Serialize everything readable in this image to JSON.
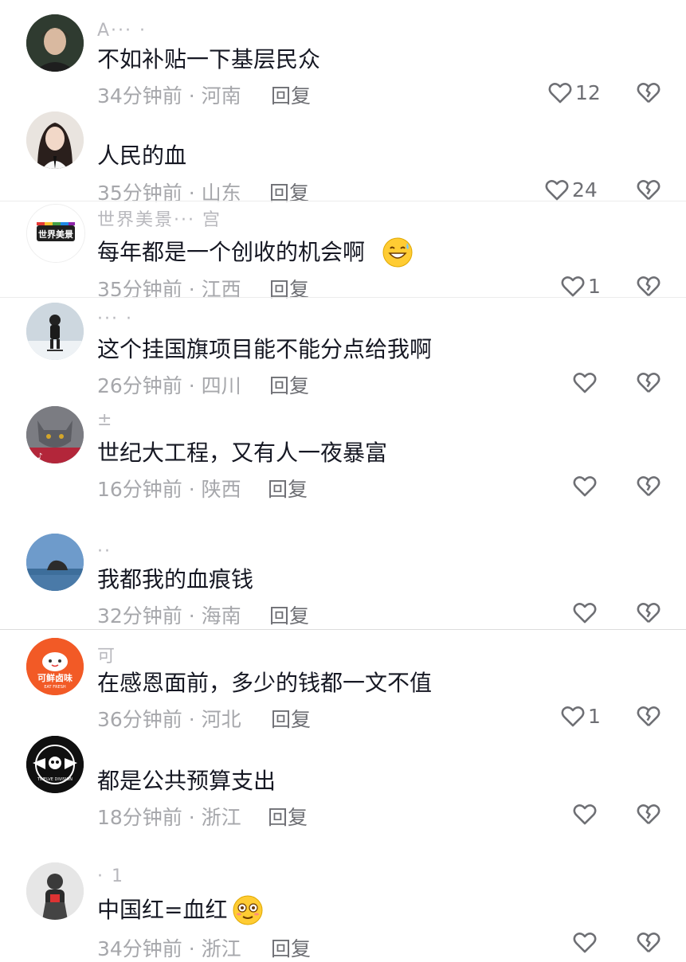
{
  "comments": [
    {
      "user": "A··· ·",
      "text": "不如补贴一下基层民众",
      "time": "34分钟前 · 河南",
      "reply": "回复",
      "likes": "12",
      "avatar_color": "#2e3a2e"
    },
    {
      "user": "",
      "text": "人民的血",
      "time": "35分钟前 · 山东",
      "reply": "回复",
      "likes": "24",
      "avatar_color": "#e8e2dc"
    },
    {
      "user": "世界美景··· 宫",
      "text": "每年都是一个创收的机会啊",
      "time": "35分钟前 · 江西",
      "reply": "回复",
      "likes": "1",
      "avatar_color": "#ffffff"
    },
    {
      "user": "··· ·",
      "text": "这个挂国旗项目能不能分点给我啊",
      "time": "26分钟前 · 四川",
      "reply": "回复",
      "likes": "",
      "avatar_color": "#b7c4cf"
    },
    {
      "user": "±",
      "text": "世纪大工程，又有人一夜暴富",
      "time": "16分钟前 · 陕西",
      "reply": "回复",
      "likes": "",
      "avatar_color": "#6d6e75"
    },
    {
      "user": "··",
      "text": "我都我的血痕钱",
      "time": "32分钟前 · 海南",
      "reply": "回复",
      "likes": "",
      "avatar_color": "#5f8fc0"
    },
    {
      "user": "可",
      "text": "在感恩面前，多少的钱都一文不值",
      "time": "36分钟前 · 河北",
      "reply": "回复",
      "likes": "1",
      "avatar_color": "#f45a2a"
    },
    {
      "user": "",
      "text": "都是公共预算支出",
      "time": "18分钟前 · 浙江",
      "reply": "回复",
      "likes": "",
      "avatar_color": "#111111"
    },
    {
      "user": "·  1",
      "text": "中国红=血红",
      "time": "34分钟前 · 浙江",
      "reply": "回复",
      "likes": "",
      "avatar_color": "#dcdcdc"
    }
  ],
  "avatar_labels": {
    "brand_3": "世界美景",
    "brand_7": "可鲜卤味",
    "brand_7_sub": "EAT FRESH",
    "brand_8": "TWELVE DIVISION"
  }
}
